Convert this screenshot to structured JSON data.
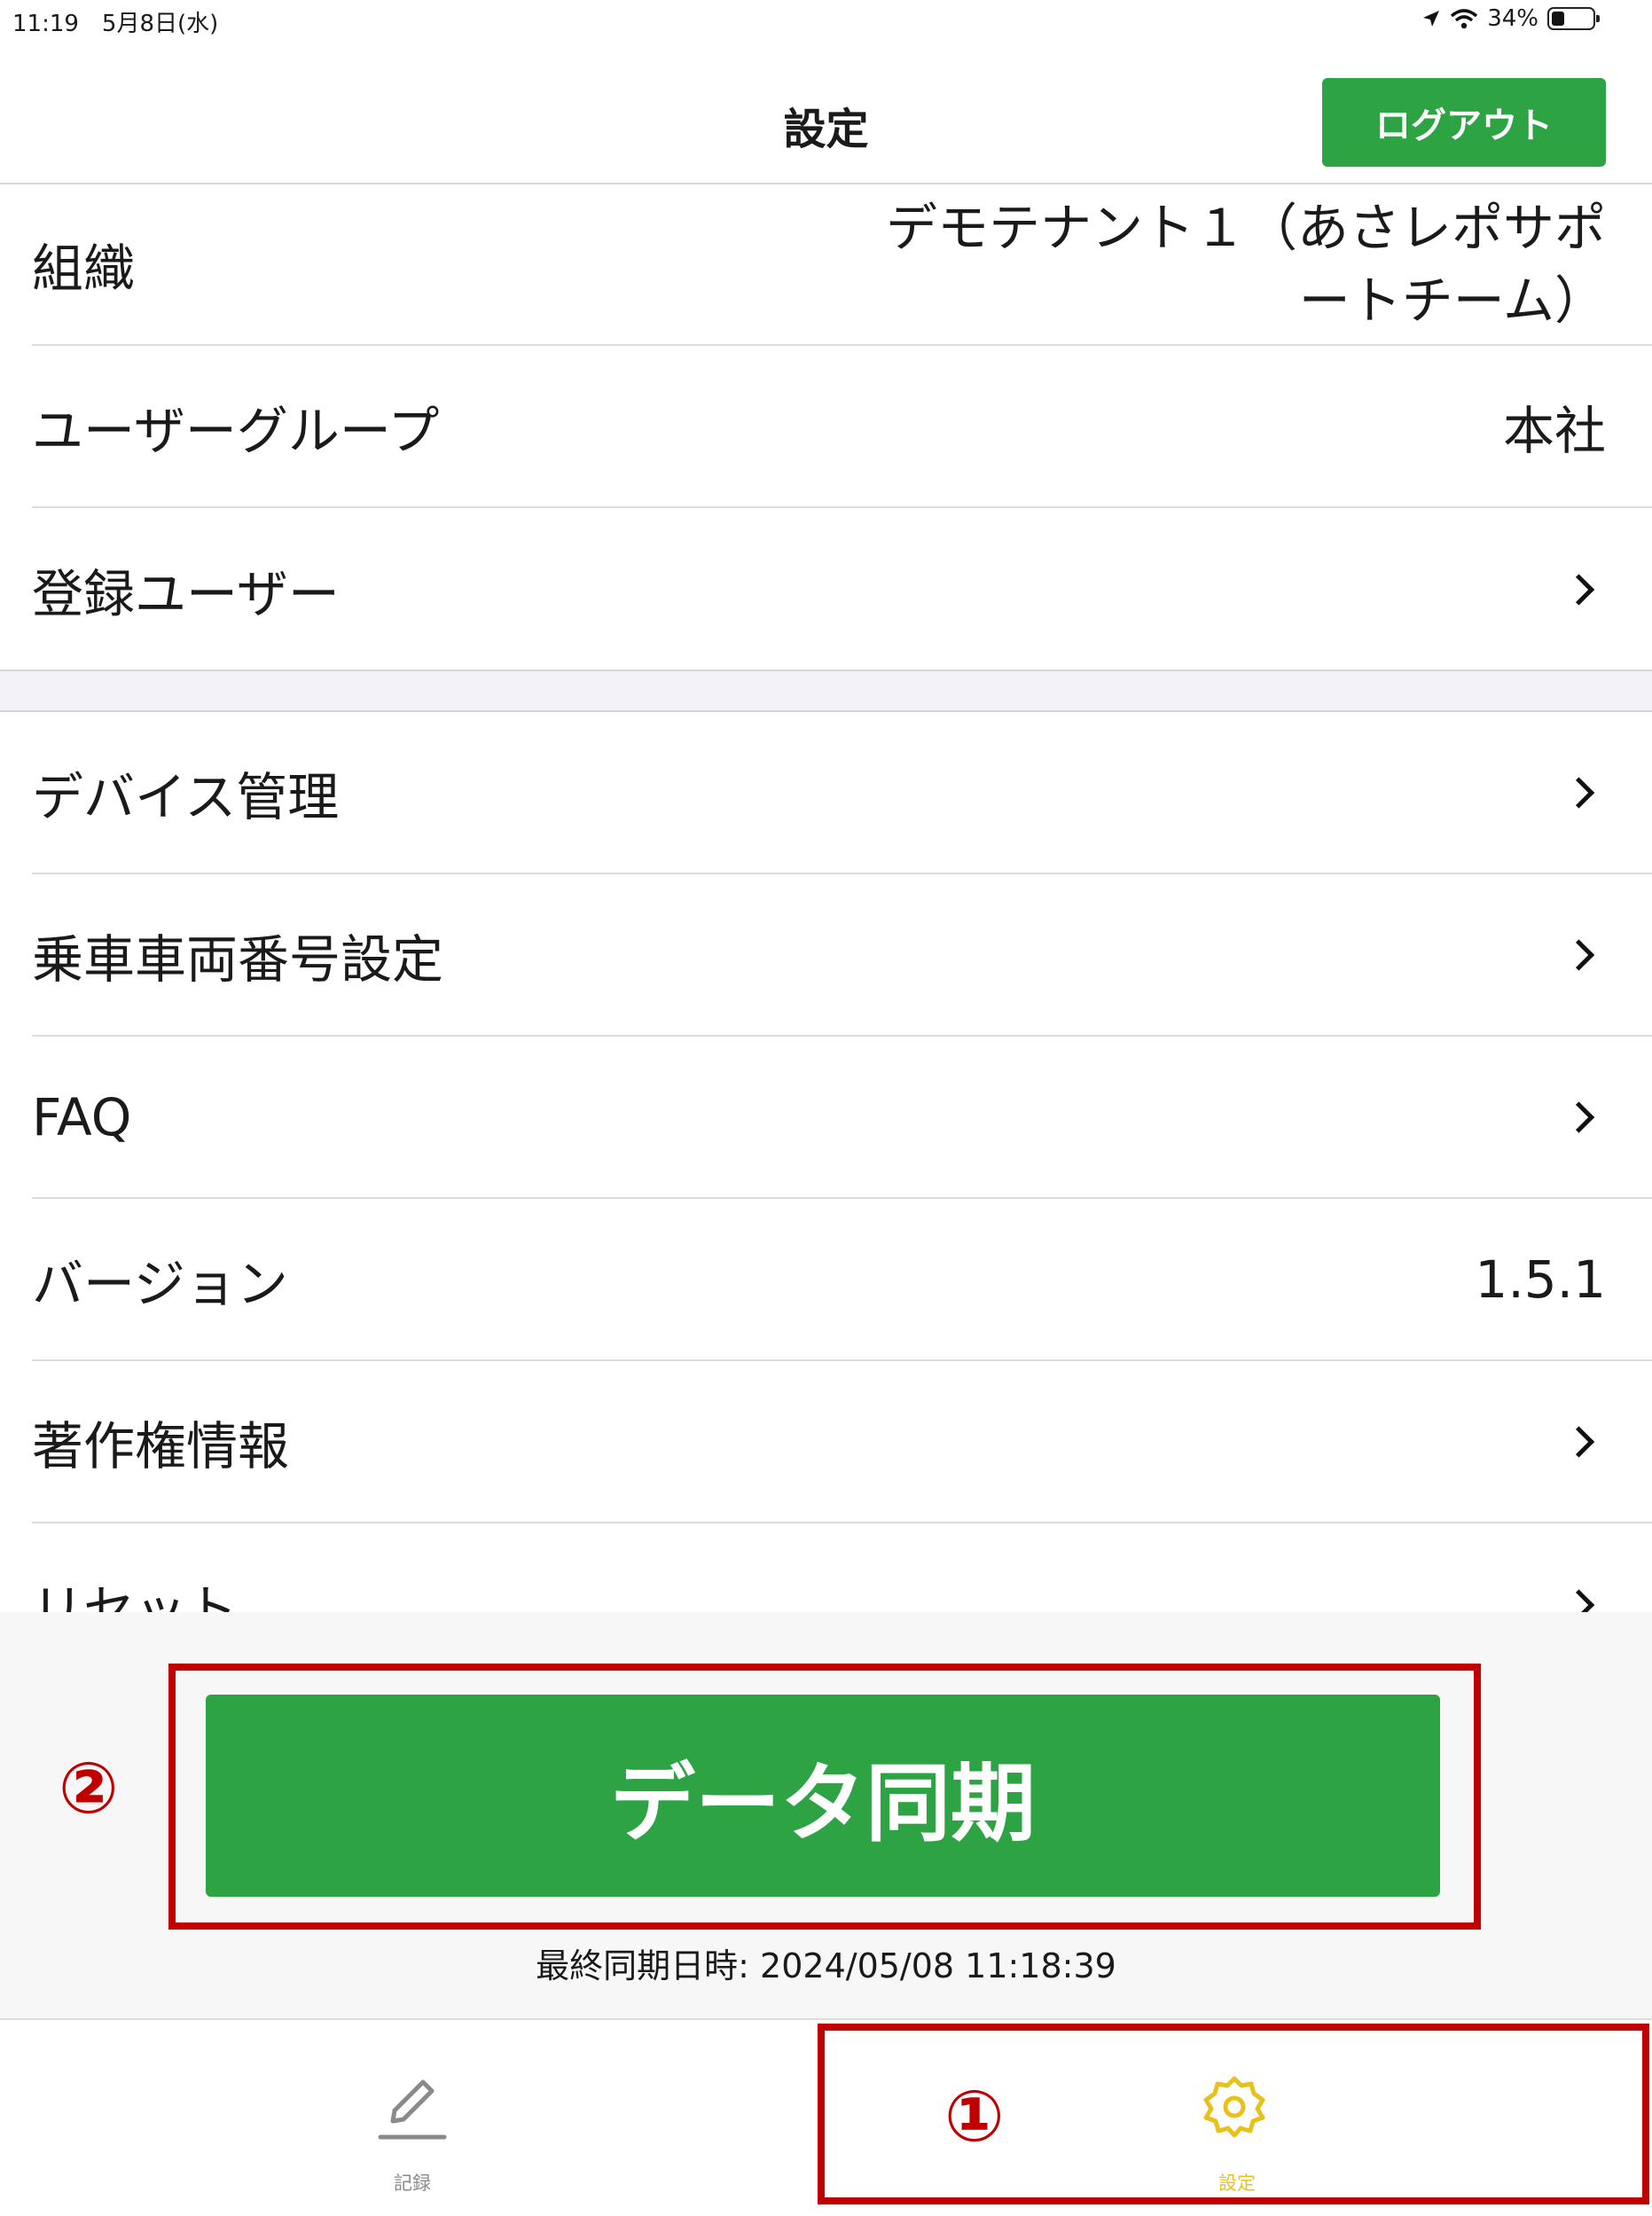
{
  "status_bar": {
    "time_date": "11:19　5月8日(水)",
    "battery": "34%",
    "battery_level": 0.34
  },
  "header": {
    "title": "設定",
    "logout_label": "ログアウト"
  },
  "settings": {
    "organization": {
      "label": "組織",
      "value": "デモテナント１（あさレポサポートチーム）"
    },
    "user_group": {
      "label": "ユーザーグループ",
      "value": "本社"
    },
    "registered_users": {
      "label": "登録ユーザー"
    },
    "device_management": {
      "label": "デバイス管理"
    },
    "vehicle_number": {
      "label": "乗車車両番号設定"
    },
    "faq": {
      "label": "FAQ"
    },
    "version": {
      "label": "バージョン",
      "value": "1.5.1"
    },
    "copyright": {
      "label": "著作権情報"
    },
    "reset": {
      "label": "リセット"
    }
  },
  "sync": {
    "button_label": "データ同期",
    "last_sync": "最終同期日時: 2024/05/08 11:18:39"
  },
  "annotations": {
    "marker_1": "①",
    "marker_2": "②"
  },
  "tab_bar": {
    "tabs": [
      {
        "label": "記録",
        "icon": "pencil-icon",
        "active": false
      },
      {
        "label": "設定",
        "icon": "gear-icon",
        "active": true
      }
    ],
    "active_color": "#e8c21b",
    "inactive_color": "#8a8a8a"
  },
  "colors": {
    "accent_green": "#2da344",
    "annotation_red": "#c00000"
  }
}
